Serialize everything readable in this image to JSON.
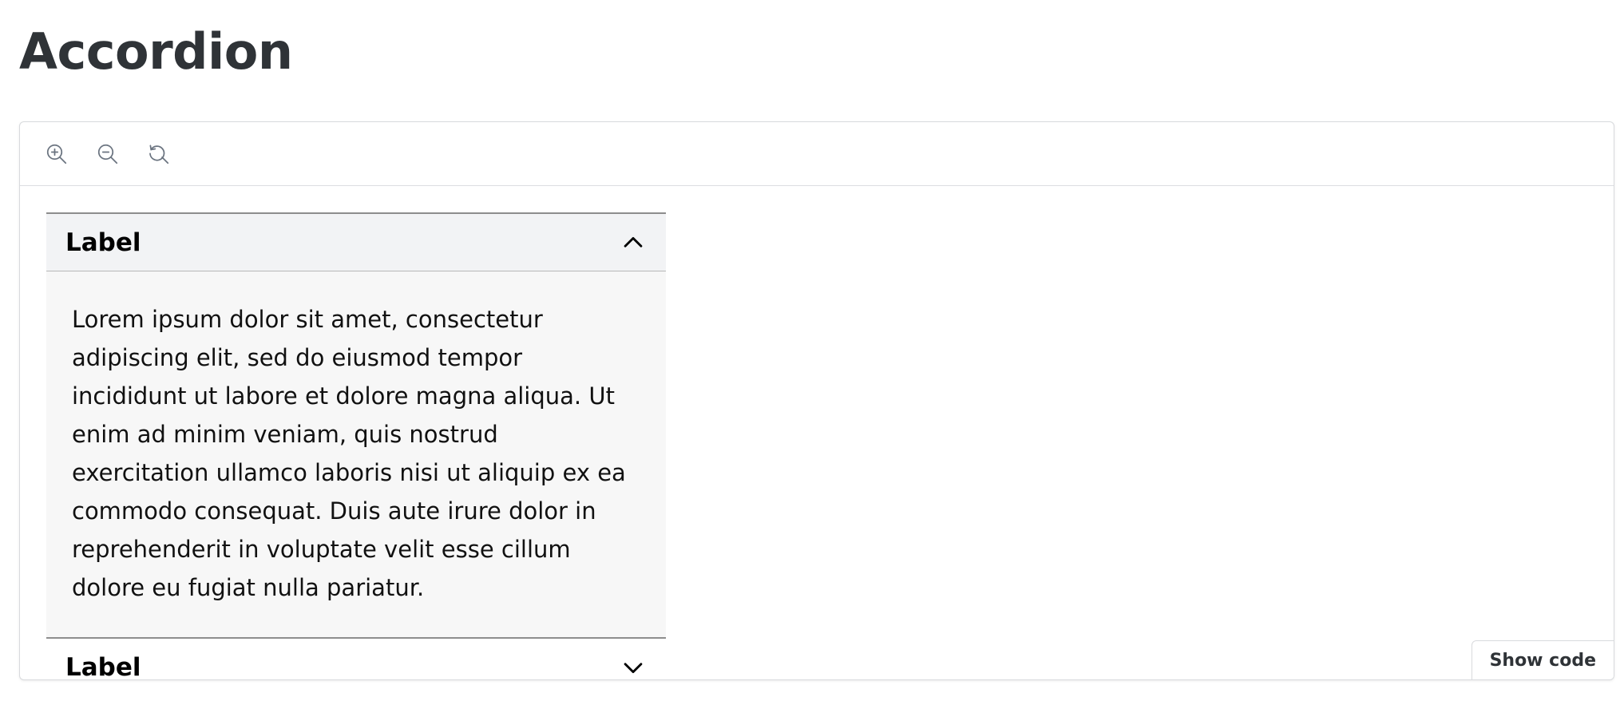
{
  "page": {
    "title": "Accordion"
  },
  "toolbar": {
    "buttons": [
      {
        "name": "zoom-in",
        "icon": "zoom-in-icon"
      },
      {
        "name": "zoom-out",
        "icon": "zoom-out-icon"
      },
      {
        "name": "reset-zoom",
        "icon": "reset-zoom-icon"
      }
    ]
  },
  "accordion": {
    "items": [
      {
        "label": "Label",
        "expanded": true,
        "content": "Lorem ipsum dolor sit amet, consectetur adipiscing elit, sed do eiusmod tempor incididunt ut labore et dolore magna aliqua. Ut enim ad minim veniam, quis nostrud exercitation ullamco laboris nisi ut aliquip ex ea commodo consequat. Duis aute irure dolor in reprehenderit in voluptate velit esse cillum dolore eu fugiat nulla pariatur."
      },
      {
        "label": "Label",
        "expanded": false
      }
    ]
  },
  "preview": {
    "show_code_label": "Show code"
  },
  "colors": {
    "title": "#2f3337",
    "header_open_bg": "#f2f3f5",
    "panel_bg": "#f7f7f7",
    "border": "#8d8d8d",
    "icon": "#6b7480"
  }
}
